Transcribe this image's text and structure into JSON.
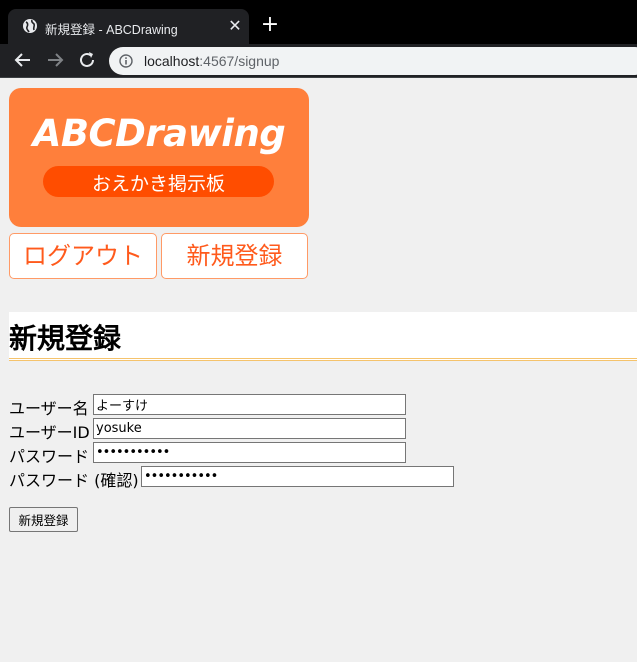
{
  "browser": {
    "tab_title": "新規登録 - ABCDrawing",
    "close_glyph": "✕",
    "new_tab_glyph": "+",
    "url_host": "localhost",
    "url_path": ":4567/signup"
  },
  "logo": {
    "brand": "ABCDrawing",
    "subtitle": "おえかき掲示板",
    "bg_color": "#ff7f3b",
    "pill_color": "#ff4d00"
  },
  "nav": {
    "logout_label": "ログアウト",
    "signup_label": "新規登録"
  },
  "page": {
    "heading": "新規登録"
  },
  "form": {
    "username_label": "ユーザー名",
    "username_value": "よーすけ",
    "userid_label": "ユーザーID",
    "userid_value": "yosuke",
    "password_label": "パスワード",
    "password_value": "•••••••••••",
    "password_confirm_label": "パスワード (確認)",
    "password_confirm_value": "•••••••••••",
    "submit_label": "新規登録"
  }
}
